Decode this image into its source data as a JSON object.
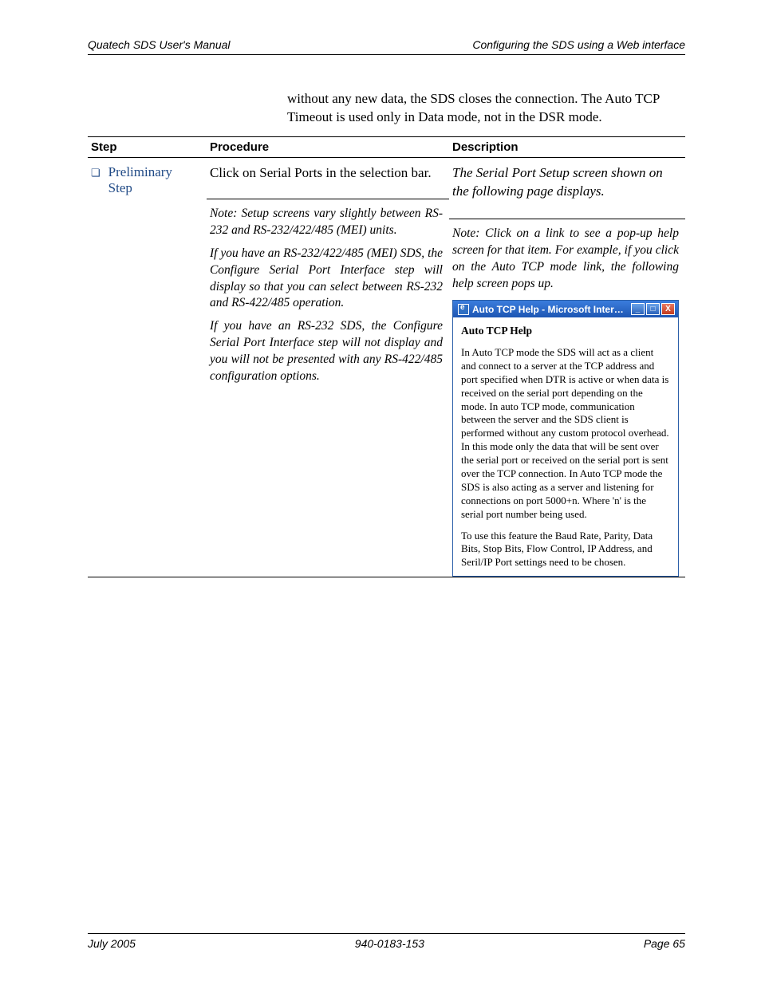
{
  "header": {
    "left": "Quatech SDS User's Manual",
    "right": "Configuring the SDS using a Web interface"
  },
  "intro": "without any new data, the SDS closes the connection. The Auto TCP Timeout is used only in Data mode, not in the DSR mode.",
  "table": {
    "columns": {
      "step": "Step",
      "procedure": "Procedure",
      "description": "Description"
    },
    "row": {
      "step_label": "Preliminary\nStep",
      "procedure": {
        "main": "Click on Serial Ports in the selection bar.",
        "note1": "Note: Setup screens vary slightly between RS-232 and RS-232/422/485 (MEI) units.",
        "note2": "If you have an RS-232/422/485 (MEI) SDS, the Configure Serial Port Interface step will display so that you can select between RS-232 and RS-422/485 operation.",
        "note3": "If you have an RS-232 SDS, the Configure Serial Port Interface step will not display and you will not be presented with any RS-422/485 configuration options."
      },
      "description": {
        "main": "The Serial Port Setup screen shown on the following page displays.",
        "note": "Note: Click on a link to see a pop-up help screen for that item. For example, if you click on the Auto TCP mode link, the following help screen pops up.",
        "popup": {
          "title": "Auto TCP Help - Microsoft Inter…",
          "heading": "Auto TCP Help",
          "para1": "In Auto TCP mode the SDS will act as a client and connect to a server at the TCP address and port specified when DTR is active or when data is received on the serial port depending on the mode. In auto TCP mode, communication between the server and the SDS client is performed without any custom protocol overhead.  In this mode only the data that will be sent over the serial port or received on the serial port is sent over the TCP connection. In Auto TCP mode the SDS is also acting as a server and listening for connections on port 5000+n. Where 'n' is the serial port number being used.",
          "para2": "To use this feature the Baud Rate, Parity, Data Bits, Stop Bits, Flow Control, IP Address, and Seril/IP Port settings need to be chosen."
        }
      }
    }
  },
  "footer": {
    "left": "July 2005",
    "center": "940-0183-153",
    "right": "Page 65"
  },
  "win_buttons": {
    "min": "_",
    "max": "□",
    "close": "X"
  }
}
